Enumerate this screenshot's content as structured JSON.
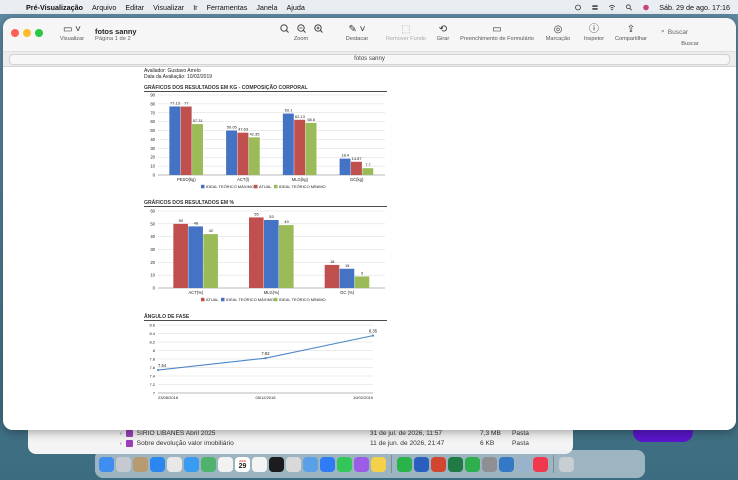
{
  "menubar": {
    "app_name": "Pré-Visualização",
    "items": [
      "Arquivo",
      "Editar",
      "Visualizar",
      "Ir",
      "Ferramentas",
      "Janela",
      "Ajuda"
    ],
    "clock": "Sáb. 29 de ago.  17:16"
  },
  "window": {
    "doc_title": "fotos sanny",
    "doc_subtitle": "Página 1 de 2",
    "tab_label": "fotos sanny",
    "toolbar": {
      "visualizar": "Visualizar",
      "zoom": "Zoom",
      "destacar": "Destacar",
      "remover_fundo": "Remover Fundo",
      "girar": "Girar",
      "preenchimento": "Preenchimento de Formulário",
      "marcacao": "Marcação",
      "inspetor": "Inspetor",
      "compartilhar": "Compartilhar",
      "buscar": "Buscar",
      "search_placeholder": "Buscar"
    }
  },
  "document": {
    "avaliador": "Avaliador: Gustavo Arrelo",
    "data_avaliacao": "Data da Avaliação: 10/02/2019",
    "legend": [
      "IDEAL TEÓRICO MÁXIMO",
      "ATUAL",
      "IDEAL TEÓRICO MÍNIMO"
    ],
    "colors": {
      "max": "#4472c4",
      "atual": "#c0504d",
      "min": "#9bbb59",
      "line": "#4f88c6"
    }
  },
  "chart_data": [
    {
      "type": "bar",
      "title": "GRÁFICOS DOS RESULTADOS EM KG - COMPOSIÇÃO CORPORAL",
      "categories": [
        "PESO(kg)",
        "ACT(l)",
        "MLG(kg)",
        "GC(kg)"
      ],
      "series": [
        {
          "name": "IDEAL TEÓRICO MÁXIMO",
          "values": [
            77.13,
            50.05,
            69.1,
            18.4
          ]
        },
        {
          "name": "ATUAL",
          "values": [
            77,
            47.63,
            62.13,
            14.87
          ]
        },
        {
          "name": "IDEAL TEÓRICO MÍNIMO",
          "values": [
            57.31,
            42.35,
            58.6,
            7.7
          ]
        }
      ],
      "value_labels": [
        [
          "77.13",
          "50.05",
          "69.1",
          "18.4"
        ],
        [
          "77",
          "47.63",
          "62.13",
          "14.87"
        ],
        [
          "57.31",
          "42.35",
          "58.6",
          "7.7"
        ]
      ],
      "ylim": [
        0,
        90
      ],
      "yticks": [
        0,
        10,
        20,
        30,
        40,
        50,
        60,
        70,
        80,
        90
      ],
      "grid": true,
      "legend_position": "bottom"
    },
    {
      "type": "bar",
      "title": "GRÁFICOS DOS RESULTADOS EM %",
      "categories": [
        "ACT(%)",
        "MLG(%)",
        "GC (%)"
      ],
      "series": [
        {
          "name": "ATUAL",
          "values": [
            50,
            55,
            18
          ]
        },
        {
          "name": "IDEAL TEÓRICO MÁXIMO",
          "values": [
            48,
            53,
            15
          ]
        },
        {
          "name": "IDEAL TEÓRICO MÍNIMO",
          "values": [
            42,
            49,
            9
          ]
        }
      ],
      "value_labels": [
        [
          "50",
          "55",
          "18"
        ],
        [
          "48",
          "53",
          "15"
        ],
        [
          "42",
          "49",
          "9"
        ]
      ],
      "ylim": [
        0,
        60
      ],
      "yticks": [
        0,
        10,
        20,
        30,
        40,
        50,
        60
      ],
      "grid": true,
      "legend_position": "bottom"
    },
    {
      "type": "line",
      "title": "ÂNGULO DE FASE",
      "x": [
        "23/08/2018",
        "05/12/2018",
        "10/02/2019"
      ],
      "series": [
        {
          "values": [
            7.54,
            7.82,
            8.35
          ]
        }
      ],
      "value_labels": [
        "7.54",
        "7.82",
        "8.35"
      ],
      "ylim": [
        7,
        8.6
      ],
      "yticks": [
        "7",
        "7.2",
        "7.4",
        "7.6",
        "7.8",
        "8",
        "8.2",
        "8.4",
        "8.6"
      ],
      "grid": true
    }
  ],
  "finder": {
    "rows": [
      {
        "name": "SIRIO LIBANÊS  Abril 2025",
        "date": "31 de jul. de 2026, 11:57",
        "size": "7,3 MB",
        "kind": "Pasta"
      },
      {
        "name": "Sobre devolução valor imobiliário",
        "date": "11 de jun. de 2026, 21:47",
        "size": "6 KB",
        "kind": "Pasta"
      }
    ]
  },
  "dock": {
    "calendar_month": "AGO",
    "calendar_day": "29",
    "apps": [
      "finder",
      "launchpad",
      "contacts",
      "mail",
      "chrome",
      "safari",
      "maps",
      "photos",
      "calendar",
      "freeform",
      "stocks",
      "screenshot",
      "preview",
      "app-store",
      "messages",
      "podcasts",
      "notes",
      "whatsapp-like",
      "word",
      "powerpoint",
      "excel",
      "numbers",
      "system-settings",
      "finder-2",
      "preview-2",
      "music",
      "trash"
    ]
  }
}
